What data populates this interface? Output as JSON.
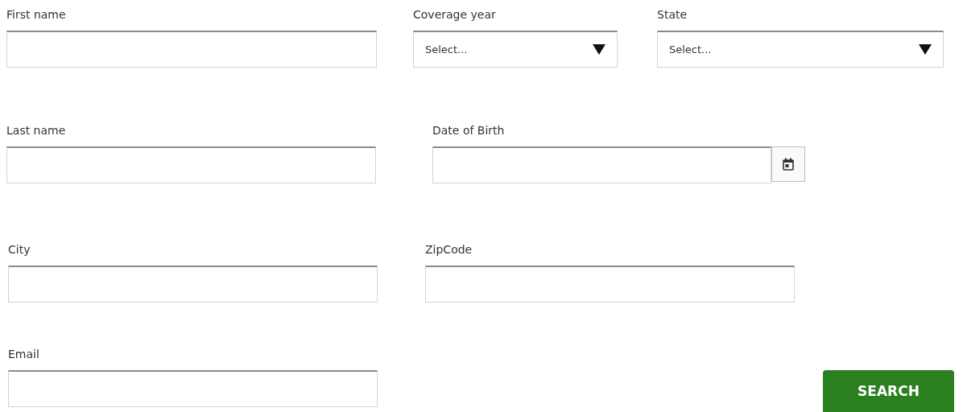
{
  "rows": [
    {
      "fields": [
        {
          "kind": "text",
          "label": "First name"
        },
        {
          "kind": "select",
          "label": "Coverage year",
          "placeholder": "Select..."
        },
        {
          "kind": "select",
          "label": "State",
          "placeholder": "Select..."
        }
      ]
    },
    {
      "fields": [
        {
          "kind": "text",
          "label": "Last name"
        },
        {
          "kind": "date",
          "label": "Date of Birth"
        }
      ]
    },
    {
      "fields": [
        {
          "kind": "text",
          "label": "City"
        },
        {
          "kind": "text",
          "label": "ZipCode"
        }
      ]
    },
    {
      "fields": [
        {
          "kind": "text",
          "label": "Email"
        }
      ]
    }
  ],
  "search_button": {
    "label": "SEARCH"
  }
}
